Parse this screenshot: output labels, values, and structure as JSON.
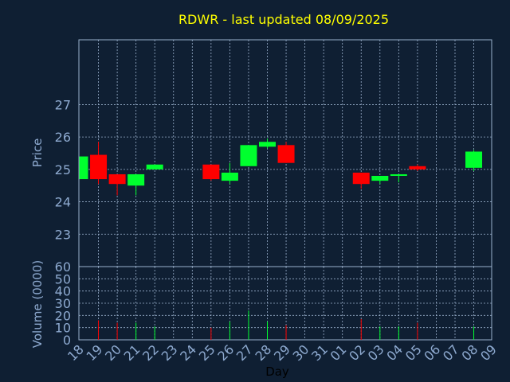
{
  "chart_data": {
    "type": "candlestick",
    "title": "RDWR - last updated 08/09/2025",
    "xlabel": "Day",
    "colors": {
      "background": "#0f1f33",
      "title": "#ffff00",
      "axis_label": "#8eaad0",
      "grid": "#9ab0cc",
      "up": "#00ff2e",
      "down": "#ff0000"
    },
    "x_ticks": [
      "18",
      "19",
      "20",
      "21",
      "22",
      "23",
      "24",
      "25",
      "26",
      "27",
      "28",
      "29",
      "30",
      "31",
      "01",
      "02",
      "03",
      "04",
      "05",
      "06",
      "07",
      "08",
      "09"
    ],
    "price_panel": {
      "ylabel": "Price",
      "ylim": [
        22,
        29
      ],
      "y_ticks": [
        23,
        24,
        25,
        26,
        27
      ],
      "grid": true
    },
    "volume_panel": {
      "ylabel": "Volume (0000)",
      "ylim": [
        0,
        60
      ],
      "y_ticks": [
        0,
        10,
        20,
        30,
        40,
        50,
        60
      ],
      "grid": true
    },
    "candles": [
      {
        "day": "18",
        "open": 24.7,
        "high": 25.4,
        "low": 24.7,
        "close": 25.4,
        "volume": 0
      },
      {
        "day": "19",
        "open": 25.45,
        "high": 25.85,
        "low": 24.55,
        "close": 24.7,
        "volume": 16
      },
      {
        "day": "20",
        "open": 24.85,
        "high": 24.85,
        "low": 24.2,
        "close": 24.55,
        "volume": 14
      },
      {
        "day": "21",
        "open": 24.5,
        "high": 24.85,
        "low": 24.2,
        "close": 24.85,
        "volume": 14
      },
      {
        "day": "22",
        "open": 25.0,
        "high": 25.15,
        "low": 25.0,
        "close": 25.15,
        "volume": 11
      },
      {
        "day": "25",
        "open": 25.15,
        "high": 25.15,
        "low": 24.65,
        "close": 24.7,
        "volume": 10
      },
      {
        "day": "26",
        "open": 24.65,
        "high": 25.2,
        "low": 24.55,
        "close": 24.9,
        "volume": 15
      },
      {
        "day": "27",
        "open": 25.1,
        "high": 25.75,
        "low": 25.1,
        "close": 25.75,
        "volume": 24
      },
      {
        "day": "28",
        "open": 25.7,
        "high": 25.95,
        "low": 25.65,
        "close": 25.85,
        "volume": 15
      },
      {
        "day": "29",
        "open": 25.75,
        "high": 25.85,
        "low": 25.2,
        "close": 25.2,
        "volume": 12
      },
      {
        "day": "02",
        "open": 24.9,
        "high": 24.9,
        "low": 24.4,
        "close": 24.55,
        "volume": 17
      },
      {
        "day": "03",
        "open": 24.65,
        "high": 24.8,
        "low": 24.55,
        "close": 24.8,
        "volume": 11
      },
      {
        "day": "04",
        "open": 24.8,
        "high": 24.85,
        "low": 24.6,
        "close": 24.85,
        "volume": 11
      },
      {
        "day": "05",
        "open": 25.1,
        "high": 25.15,
        "low": 24.95,
        "close": 25.0,
        "volume": 14
      },
      {
        "day": "08",
        "open": 25.05,
        "high": 25.6,
        "low": 24.95,
        "close": 25.55,
        "volume": 11
      }
    ]
  }
}
